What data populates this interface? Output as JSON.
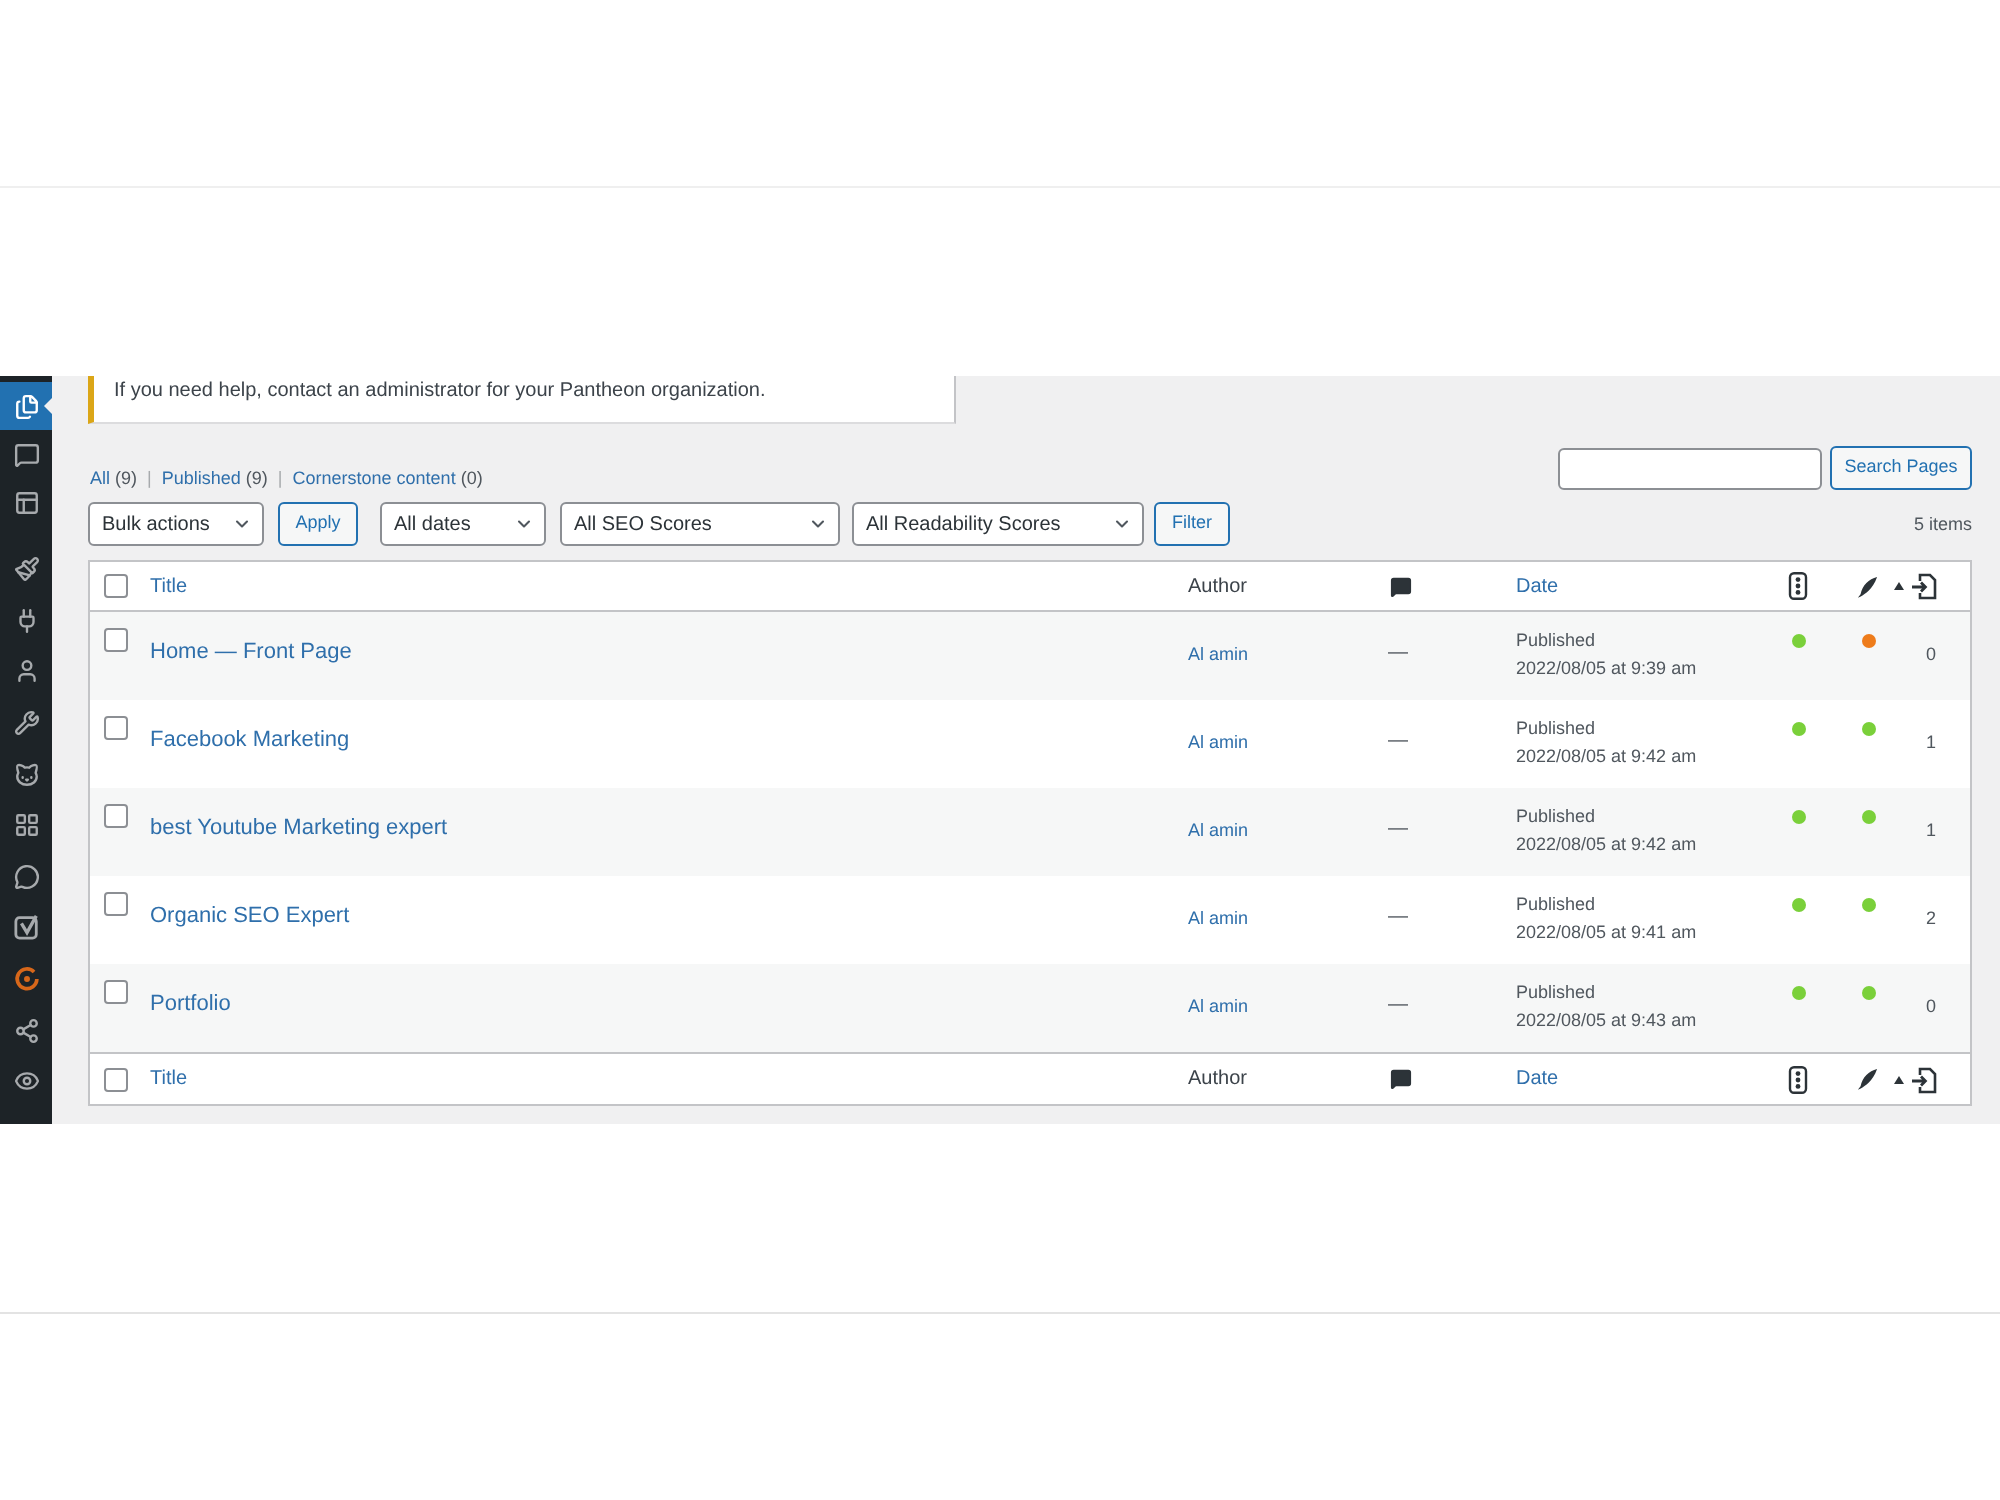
{
  "sidebar": {
    "groups": [
      {
        "items": [
          {
            "kind": "pages",
            "selected": true
          },
          {
            "kind": "comments",
            "selected": false
          },
          {
            "kind": "layout",
            "selected": false
          }
        ]
      },
      {
        "items": [
          {
            "kind": "brush",
            "selected": false
          },
          {
            "kind": "plugins",
            "selected": false
          },
          {
            "kind": "users",
            "selected": false
          },
          {
            "kind": "tools",
            "selected": false
          },
          {
            "kind": "animal",
            "selected": false
          },
          {
            "kind": "grid",
            "selected": false
          },
          {
            "kind": "chat",
            "selected": false
          },
          {
            "kind": "logo",
            "selected": false
          },
          {
            "kind": "ring",
            "selected": false
          },
          {
            "kind": "share",
            "selected": false
          },
          {
            "kind": "eye",
            "selected": false
          }
        ]
      }
    ]
  },
  "notice": {
    "text": "If you need help, contact an administrator for your Pantheon organization."
  },
  "views": [
    {
      "label": "All",
      "count": "(9)",
      "separator": "|"
    },
    {
      "label": "Published",
      "count": "(9)",
      "separator": "|"
    },
    {
      "label": "Cornerstone content",
      "count": "(0)"
    }
  ],
  "search": {
    "button": "Search Pages"
  },
  "filters": {
    "bulk_actions": "Bulk actions",
    "apply": "Apply",
    "dates": "All dates",
    "seo_scores": "All SEO Scores",
    "readability_scores": "All Readability Scores",
    "filter": "Filter"
  },
  "item_count": "5 items",
  "table": {
    "header": {
      "checked": false,
      "columns": [
        {
          "kind": "title",
          "label": "Title"
        },
        {
          "kind": "author",
          "label": "Author"
        },
        {
          "kind": "comments"
        },
        {
          "kind": "date",
          "label": "Date"
        },
        {
          "kind": "seo"
        },
        {
          "kind": "readability"
        },
        {
          "kind": "links",
          "sorted": true
        }
      ]
    },
    "rows": [
      {
        "checked": false,
        "title": "Home — Front Page",
        "author": "Al amin",
        "comments": "—",
        "status": "Published",
        "date": "2022/08/05 at 9:39 am",
        "seo": {
          "color": "#7ad03a"
        },
        "readability": {
          "color": "#ee7c1b"
        },
        "links": "0"
      },
      {
        "checked": false,
        "title": "Facebook Marketing",
        "author": "Al amin",
        "comments": "—",
        "status": "Published",
        "date": "2022/08/05 at 9:42 am",
        "seo": {
          "color": "#7ad03a"
        },
        "readability": {
          "color": "#7ad03a"
        },
        "links": "1"
      },
      {
        "checked": false,
        "title": "best Youtube Marketing expert",
        "author": "Al amin",
        "comments": "—",
        "status": "Published",
        "date": "2022/08/05 at 9:42 am",
        "seo": {
          "color": "#7ad03a"
        },
        "readability": {
          "color": "#7ad03a"
        },
        "links": "1"
      },
      {
        "checked": false,
        "title": "Organic SEO Expert",
        "author": "Al amin",
        "comments": "—",
        "status": "Published",
        "date": "2022/08/05 at 9:41 am",
        "seo": {
          "color": "#7ad03a"
        },
        "readability": {
          "color": "#7ad03a"
        },
        "links": "2"
      },
      {
        "checked": false,
        "title": "Portfolio",
        "author": "Al amin",
        "comments": "—",
        "status": "Published",
        "date": "2022/08/05 at 9:43 am",
        "seo": {
          "color": "#7ad03a"
        },
        "readability": {
          "color": "#7ad03a"
        },
        "links": "0"
      }
    ],
    "footer": {
      "checked": false,
      "columns": [
        {
          "kind": "title",
          "label": "Title"
        },
        {
          "kind": "author",
          "label": "Author"
        },
        {
          "kind": "comments"
        },
        {
          "kind": "date",
          "label": "Date"
        },
        {
          "kind": "seo"
        },
        {
          "kind": "readability"
        },
        {
          "kind": "links",
          "sorted": true
        }
      ]
    }
  }
}
